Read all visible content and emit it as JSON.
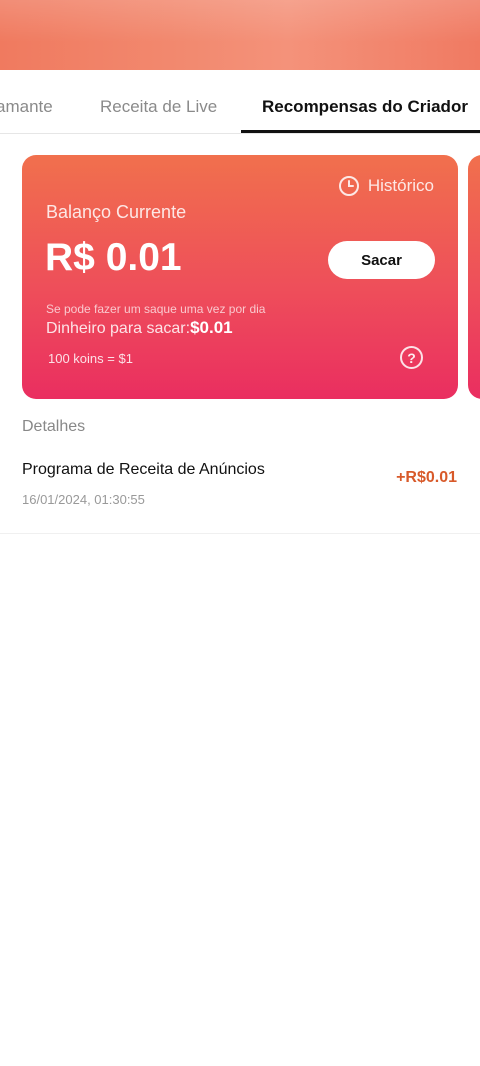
{
  "tabs": [
    {
      "label": "amante"
    },
    {
      "label": "Receita de Live"
    },
    {
      "label": "Recompensas do Criador"
    }
  ],
  "card": {
    "history_label": "Histórico",
    "balance_label": "Balanço Currente",
    "balance_value": "R$ 0.01",
    "withdraw_button": "Sacar",
    "note": "Se pode fazer um saque uma vez por dia",
    "withdrawable_label": "Dinheiro para sacar:",
    "withdrawable_value": "$0.01",
    "rate": "100 koins = $1",
    "help_symbol": "?"
  },
  "details": {
    "title": "Detalhes",
    "items": [
      {
        "name": "Programa de Receita de Anúncios",
        "date": "16/01/2024, 01:30:55",
        "amount": "+R$0.01"
      }
    ]
  },
  "colors": {
    "card_gradient_top": "#f1704d",
    "card_gradient_bottom": "#ea2e60",
    "amount_color": "#d85a2a"
  }
}
